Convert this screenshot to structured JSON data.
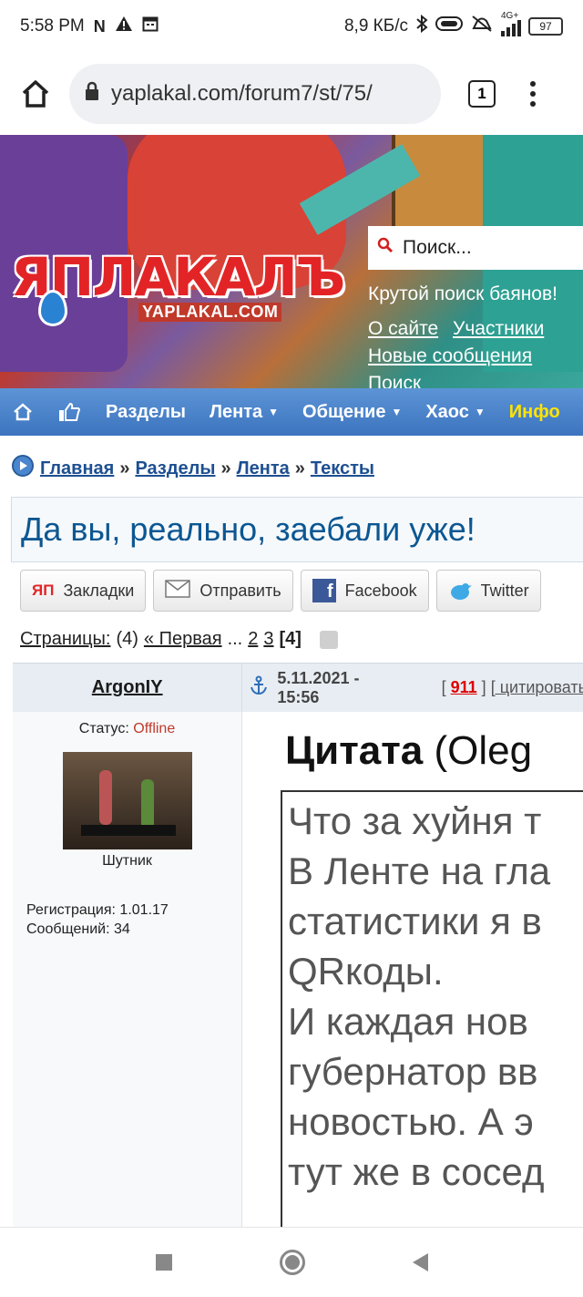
{
  "status_bar": {
    "time": "5:58 PM",
    "speed": "8,9 КБ/с",
    "network": "4G+",
    "battery": "97",
    "icons": [
      "netflix-icon",
      "alert-icon",
      "calendar-icon",
      "bluetooth-icon",
      "vpn-icon",
      "mute-icon",
      "signal-icon",
      "battery-icon"
    ]
  },
  "browser": {
    "url": "yaplakal.com/forum7/st/75/",
    "tab_count": "1"
  },
  "header": {
    "logo_title": "ЯПЛАКАЛЪ",
    "logo_sub": "YAPLAKAL.COM",
    "search_placeholder": "Поиск...",
    "tagline": "Крутой поиск баянов!",
    "links": [
      "О сайте",
      "Участники",
      "Новые сообщения",
      "Поиск"
    ]
  },
  "nav": {
    "items": [
      {
        "label": "Разделы",
        "dropdown": false
      },
      {
        "label": "Лента",
        "dropdown": true
      },
      {
        "label": "Общение",
        "dropdown": true
      },
      {
        "label": "Хаос",
        "dropdown": true
      },
      {
        "label": "Инфо",
        "dropdown": false
      }
    ]
  },
  "breadcrumbs": {
    "items": [
      "Главная",
      "Разделы",
      "Лента",
      "Тексты"
    ],
    "separator": "»"
  },
  "topic": {
    "title": "Да вы, реально, заебали уже!"
  },
  "share": {
    "bookmarks": "Закладки",
    "bookmarks_badge": "ЯП",
    "send": "Отправить",
    "facebook": "Facebook",
    "twitter": "Twitter"
  },
  "pagination": {
    "label": "Страницы:",
    "count": "(4)",
    "first": "« Первая",
    "ellipsis": "...",
    "p2": "2",
    "p3": "3",
    "current": "[4]"
  },
  "post": {
    "author": "ArgonIY",
    "date": "5.11.2021 - 15:56",
    "rating_open": "[",
    "rating": "911",
    "rating_close": "]",
    "quote_link": "[ цитировать ]",
    "status_label": "Статус:",
    "status_value": "Offline",
    "rank": "Шутник",
    "registration": "Регистрация: 1.01.17",
    "messages": "Сообщений: 34",
    "quote_label": "Цитата",
    "quote_author": "(Oleg",
    "quote_lines": [
      "Что за хуйня т",
      "В Ленте на гла",
      "статистики я в",
      "QRкоды.",
      "И каждая нов",
      "губернатор вв",
      "новостью. А э",
      "тут же в сосед"
    ]
  }
}
